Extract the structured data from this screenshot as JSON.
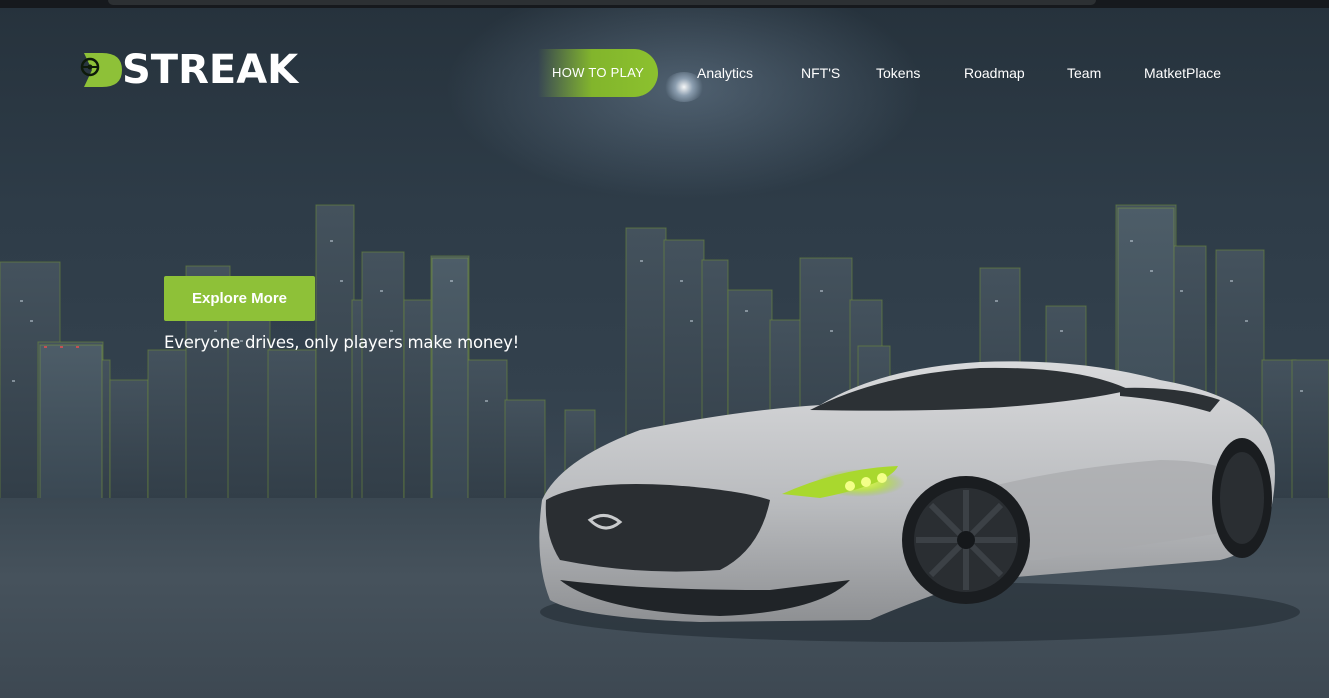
{
  "brand": {
    "name": "STREAK",
    "logo_icon": "steering-wheel-icon"
  },
  "nav": {
    "items": [
      {
        "label": "HOW TO PLAY",
        "active": true
      },
      {
        "label": "Analytics",
        "active": false
      },
      {
        "label": "NFT'S",
        "active": false
      },
      {
        "label": "Tokens",
        "active": false
      },
      {
        "label": "Roadmap",
        "active": false
      },
      {
        "label": "Team",
        "active": false
      },
      {
        "label": "MatketPlace",
        "active": false
      }
    ]
  },
  "hero": {
    "cta_label": "Explore More",
    "tagline": "Everyone drives, only players make money!"
  },
  "colors": {
    "accent": "#8ec138",
    "headlight": "#c8f03a",
    "text": "#ffffff"
  }
}
